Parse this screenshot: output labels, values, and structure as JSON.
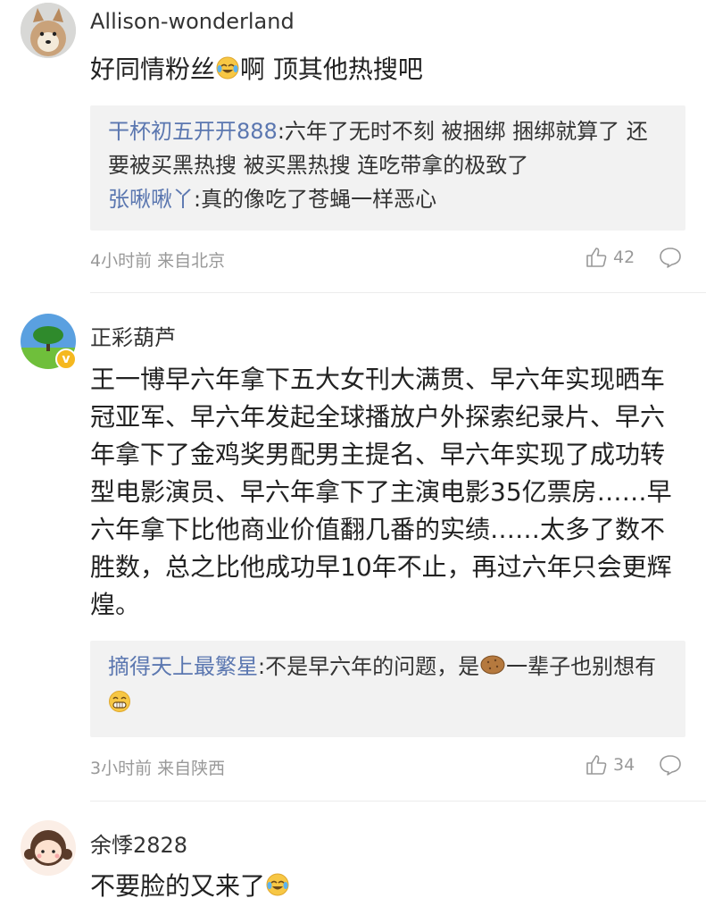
{
  "comments": [
    {
      "username": "Allison-wonderland",
      "content": "好同情粉丝",
      "content_suffix": "啊 顶其他热搜吧",
      "content_emoji": "laughing-crying-emoji",
      "replies": [
        {
          "user": "干杯初五开开888",
          "text": ":六年了无时不刻 被捆绑 捆绑就算了 还要被买黑热搜 被买黑热搜 连吃带拿的极致了"
        },
        {
          "user": "张啾啾丫",
          "text": ":真的像吃了苍蝇一样恶心"
        }
      ],
      "meta": "4小时前 来自北京",
      "likes": "42"
    },
    {
      "username": "正彩葫芦",
      "verified_badge": "v",
      "content": "王一博早六年拿下五大女刊大满贯、早六年实现晒车冠亚军、早六年发起全球播放户外探索纪录片、早六年拿下了金鸡奖男配男主提名、早六年实现了成功转型电影演员、早六年拿下了主演电影35亿票房……早六年拿下比他商业价值翻几番的实绩……太多了数不胜数，总之比他成功早10年不止，再过六年只会更辉煌。",
      "replies": [
        {
          "user": "摘得天上最繁星",
          "text": ":不是早六年的问题，是",
          "text_emoji": "potato-emoji",
          "text_after": "一辈子也别想有",
          "end_emoji": "grinning-emoji"
        }
      ],
      "meta": "3小时前 来自陕西",
      "likes": "34"
    },
    {
      "username": "余悸2828",
      "content": "不要脸的又来了",
      "content_emoji": "laughing-crying-emoji"
    }
  ],
  "colors": {
    "reply_user": "#5b77b0",
    "meta_text": "#999999",
    "reply_bg": "#f2f2f2",
    "verified": "#f5b81f"
  }
}
